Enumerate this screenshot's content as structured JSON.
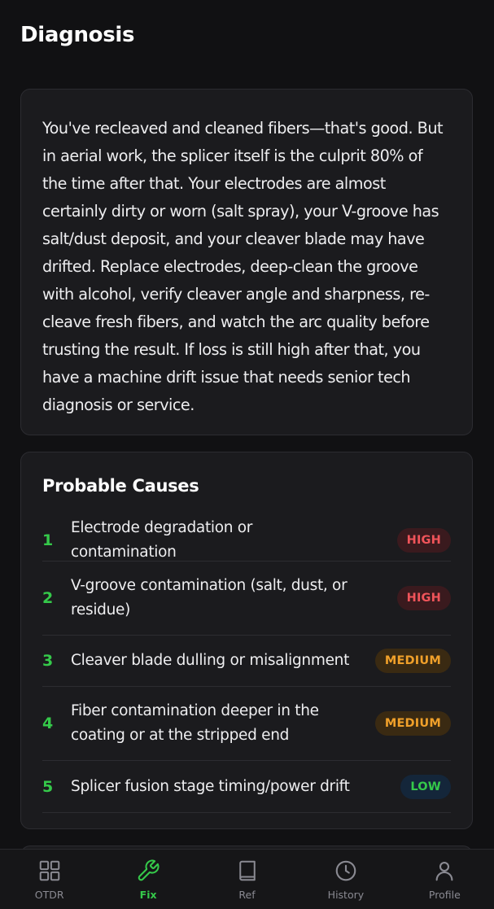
{
  "header": {
    "title": "Diagnosis"
  },
  "diagnosis": {
    "text": "You've recleaved and cleaned fibers—that's good. But in aerial work, the splicer itself is the culprit 80% of the time after that. Your electrodes are almost certainly dirty or worn (salt spray), your V-groove has salt/dust deposit, and your cleaver blade may have drifted. Replace electrodes, deep-clean the groove with alcohol, verify cleaver angle and sharpness, re-cleave fresh fibers, and watch the arc quality before trusting the result. If loss is still high after that, you have a machine drift issue that needs senior tech diagnosis or service."
  },
  "causes": {
    "title": "Probable Causes",
    "items": [
      {
        "num": "1",
        "text": "Electrode degradation or contamination",
        "severity": "HIGH",
        "level": "high"
      },
      {
        "num": "2",
        "text": "V-groove contamination (salt, dust, or residue)",
        "severity": "HIGH",
        "level": "high"
      },
      {
        "num": "3",
        "text": "Cleaver blade dulling or misalignment",
        "severity": "MEDIUM",
        "level": "medium"
      },
      {
        "num": "4",
        "text": "Fiber contamination deeper in the coating or at the stripped end",
        "severity": "MEDIUM",
        "level": "medium"
      },
      {
        "num": "5",
        "text": "Splicer fusion stage timing/power drift",
        "severity": "LOW",
        "level": "low"
      }
    ]
  },
  "tabbar": {
    "active": "Fix",
    "accent_color": "#35c94a",
    "tabs": [
      {
        "label": "OTDR",
        "icon": "grid-icon"
      },
      {
        "label": "Fix",
        "icon": "wrench-icon"
      },
      {
        "label": "Ref",
        "icon": "book-icon"
      },
      {
        "label": "History",
        "icon": "clock-icon"
      },
      {
        "label": "Profile",
        "icon": "user-icon"
      }
    ]
  }
}
